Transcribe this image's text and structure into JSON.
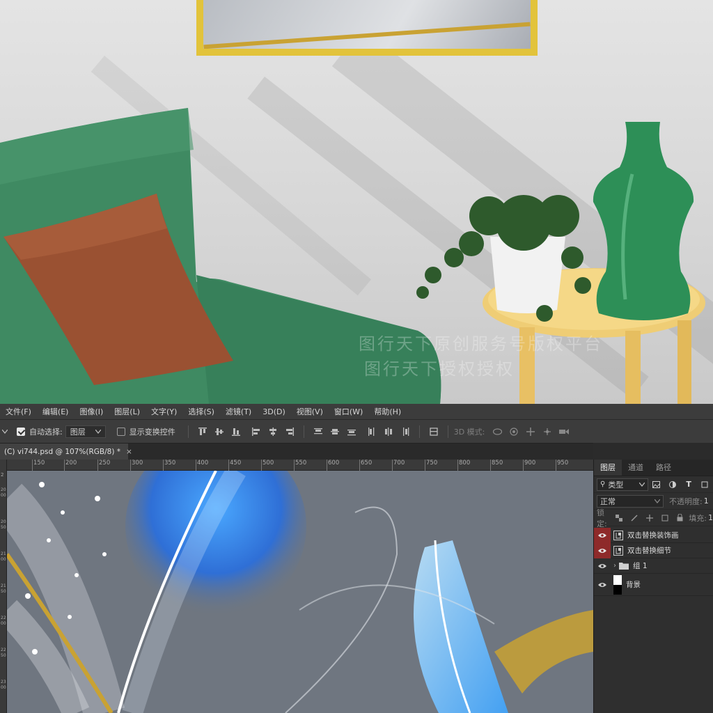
{
  "watermark": {
    "line1": "图行天下原创服务号版权平台",
    "line2": "图行天下授权授权"
  },
  "menu": [
    "文件(F)",
    "编辑(E)",
    "图像(I)",
    "图层(L)",
    "文字(Y)",
    "选择(S)",
    "滤镜(T)",
    "3D(D)",
    "视图(V)",
    "窗口(W)",
    "帮助(H)"
  ],
  "options": {
    "auto_select_label": "自动选择:",
    "auto_select_value": "图层",
    "show_transform_label": "显示变换控件",
    "mode_3d_label": "3D 模式:"
  },
  "document": {
    "tab_title": "(C) vi744.psd @ 107%(RGB/8) *",
    "close": "×"
  },
  "ruler": {
    "h_ticks": [
      "150",
      "200",
      "250",
      "300",
      "350",
      "400",
      "450",
      "500",
      "550",
      "600",
      "650",
      "700",
      "750",
      "800",
      "850",
      "900",
      "950"
    ],
    "v_ticks": [
      "2",
      "2000",
      "2050",
      "2100",
      "2150",
      "2200",
      "2250",
      "2300"
    ]
  },
  "layers_panel": {
    "tabs": [
      "图层",
      "通道",
      "路径"
    ],
    "filter_kind": "类型",
    "blend_mode": "正常",
    "opacity_label": "不透明度:",
    "opacity_value": "1",
    "lock_label": "锁定:",
    "fill_label": "填充:",
    "fill_value": "1",
    "layers": [
      {
        "name": "双击替换装饰画",
        "type": "smart",
        "visible": true,
        "highlighted": true
      },
      {
        "name": "双击替换细节",
        "type": "smart",
        "visible": true,
        "highlighted": true
      },
      {
        "name": "组 1",
        "type": "group",
        "visible": true,
        "highlighted": false
      },
      {
        "name": "背景",
        "type": "background",
        "visible": true,
        "highlighted": false
      }
    ]
  },
  "colors": {
    "frame_gold": "#e2c33b",
    "armchair": "#3f8a62",
    "cushion": "#9a5132",
    "table": "#efcd75",
    "vase": "#2d8f57",
    "canvas_bg": "#6f7680",
    "feather_blue": "#2f8fe0",
    "glitter_gold": "#c9a233",
    "highlight_red": "#8e2a2a"
  }
}
